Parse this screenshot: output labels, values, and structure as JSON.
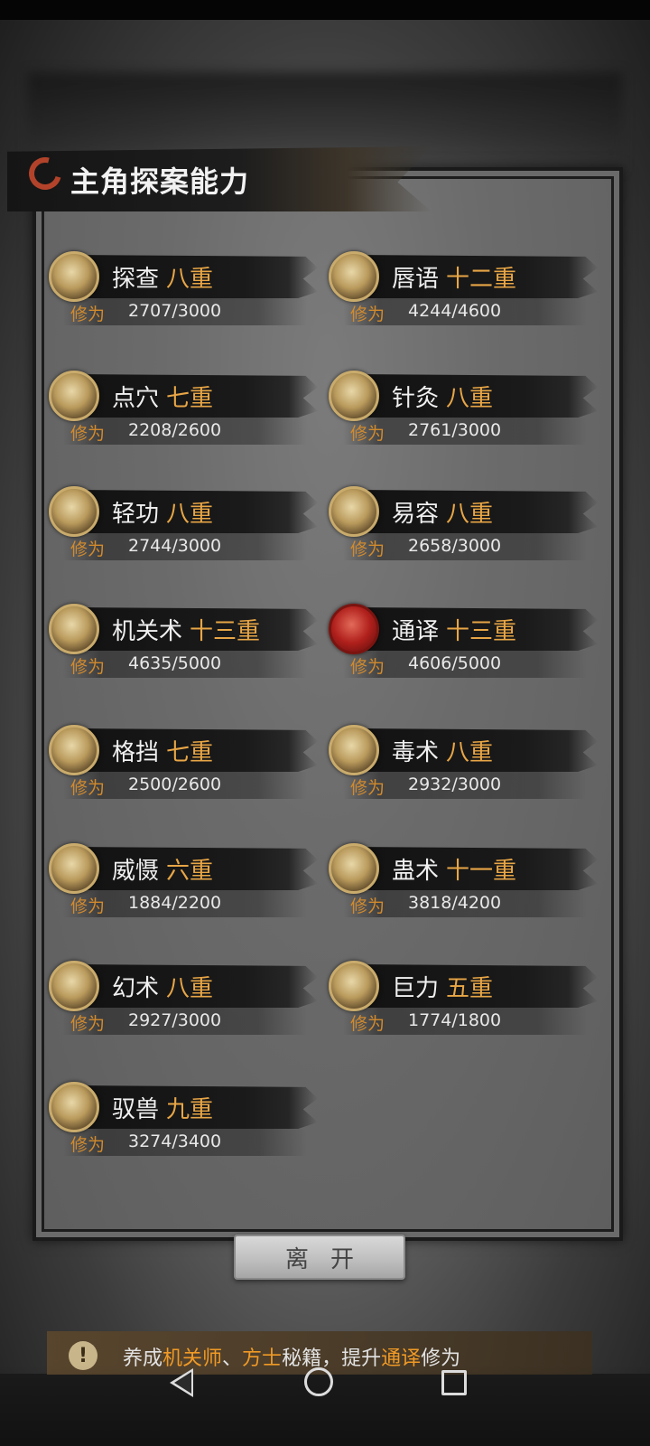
{
  "header": {
    "title": "主角探案能力"
  },
  "xp_label": "修为",
  "skills": [
    {
      "name": "探查",
      "level": "八重",
      "xp": "2707/3000",
      "icon": "detective-icon"
    },
    {
      "name": "唇语",
      "level": "十二重",
      "xp": "4244/4600",
      "icon": "lips-icon"
    },
    {
      "name": "点穴",
      "level": "七重",
      "xp": "2208/2600",
      "icon": "pressure-point-icon"
    },
    {
      "name": "针灸",
      "level": "八重",
      "xp": "2761/3000",
      "icon": "acupuncture-icon"
    },
    {
      "name": "轻功",
      "level": "八重",
      "xp": "2744/3000",
      "icon": "lightfoot-icon"
    },
    {
      "name": "易容",
      "level": "八重",
      "xp": "2658/3000",
      "icon": "disguise-icon"
    },
    {
      "name": "机关术",
      "level": "十三重",
      "xp": "4635/5000",
      "icon": "gear-icon"
    },
    {
      "name": "通译",
      "level": "十三重",
      "xp": "4606/5000",
      "icon": "lantern-icon"
    },
    {
      "name": "格挡",
      "level": "七重",
      "xp": "2500/2600",
      "icon": "block-icon"
    },
    {
      "name": "毒术",
      "level": "八重",
      "xp": "2932/3000",
      "icon": "spider-icon"
    },
    {
      "name": "威慑",
      "level": "六重",
      "xp": "1884/2200",
      "icon": "intimidate-icon"
    },
    {
      "name": "蛊术",
      "level": "十一重",
      "xp": "3818/4200",
      "icon": "gu-icon"
    },
    {
      "name": "幻术",
      "level": "八重",
      "xp": "2927/3000",
      "icon": "illusion-icon"
    },
    {
      "name": "巨力",
      "level": "五重",
      "xp": "1774/1800",
      "icon": "strength-icon"
    },
    {
      "name": "驭兽",
      "level": "九重",
      "xp": "3274/3400",
      "icon": "wolf-icon"
    }
  ],
  "leave_button": "离开",
  "tip": {
    "icon": "!",
    "part1": "养成",
    "hl1": "机关师",
    "part2": "、",
    "hl2": "方士",
    "part3": "秘籍，提升",
    "hl3": "通译",
    "part4": "修为"
  },
  "colors": {
    "level": "#e8a646",
    "xp_label": "#d28a2c",
    "highlight": "#f09a26"
  }
}
